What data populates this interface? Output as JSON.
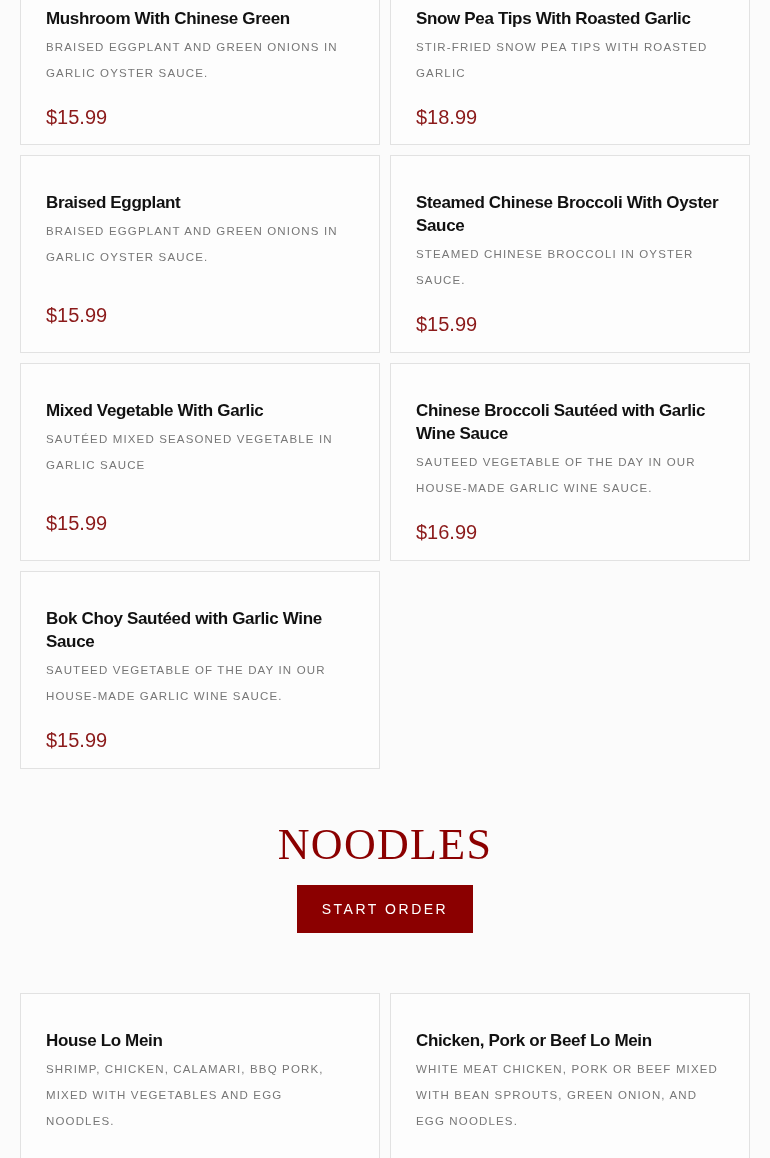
{
  "vegetable_items": [
    {
      "name": "Mushroom With Chinese Green",
      "description": "BRAISED EGGPLANT AND GREEN ONIONS IN GARLIC OYSTER SAUCE.",
      "price": "$15.99"
    },
    {
      "name": "Snow Pea Tips With Roasted Garlic",
      "description": "STIR-FRIED SNOW PEA TIPS WITH ROASTED GARLIC",
      "price": "$18.99"
    },
    {
      "name": "Braised Eggplant",
      "description": "BRAISED EGGPLANT AND GREEN ONIONS IN GARLIC OYSTER SAUCE.",
      "price": "$15.99"
    },
    {
      "name": "Steamed Chinese Broccoli With Oyster Sauce",
      "description": "STEAMED CHINESE BROCCOLI IN OYSTER SAUCE.",
      "price": "$15.99"
    },
    {
      "name": "Mixed Vegetable With Garlic",
      "description": "SAUTÉED MIXED SEASONED VEGETABLE IN GARLIC SAUCE",
      "price": "$15.99"
    },
    {
      "name": "Chinese Broccoli Sautéed with Garlic Wine Sauce",
      "description": "SAUTEED VEGETABLE OF THE DAY IN OUR HOUSE-MADE GARLIC WINE SAUCE.",
      "price": "$16.99"
    },
    {
      "name": "Bok Choy Sautéed with Garlic Wine Sauce",
      "description": "SAUTEED VEGETABLE OF THE DAY IN OUR HOUSE-MADE GARLIC WINE SAUCE.",
      "price": "$15.99"
    }
  ],
  "noodles": {
    "title": "NOODLES",
    "button": "START ORDER",
    "items": [
      {
        "name": "House Lo Mein",
        "description": "SHRIMP, CHICKEN, CALAMARI, BBQ PORK, MIXED WITH VEGETABLES AND EGG NOODLES."
      },
      {
        "name": "Chicken, Pork or Beef Lo Mein",
        "description": "WHITE MEAT CHICKEN, PORK OR BEEF MIXED WITH BEAN SPROUTS, GREEN ONION, AND EGG NOODLES."
      }
    ]
  }
}
